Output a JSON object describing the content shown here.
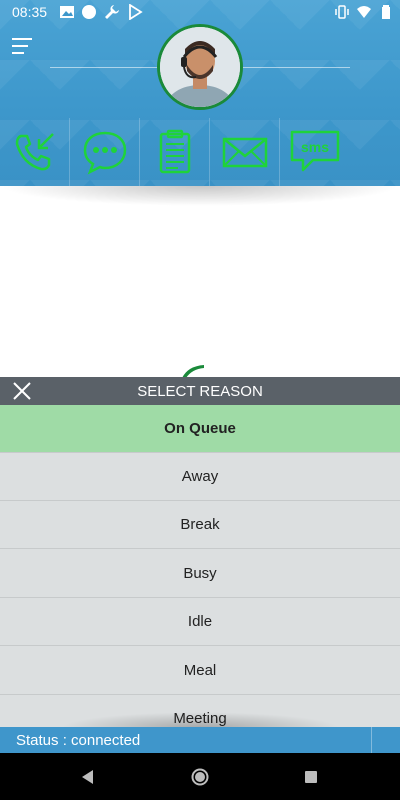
{
  "status_bar": {
    "time": "08:35",
    "left_icons": [
      "image-icon",
      "circle-icon",
      "wrench-icon",
      "play-store-icon"
    ],
    "right_icons": [
      "vibrate-icon",
      "wifi-icon",
      "battery-icon"
    ]
  },
  "header": {
    "menu_icon": "hamburger-menu-icon",
    "avatar": "agent-avatar",
    "actions": [
      {
        "name": "call-log-icon"
      },
      {
        "name": "chat-icon"
      },
      {
        "name": "clipboard-icon"
      },
      {
        "name": "email-icon"
      },
      {
        "name": "sms-icon",
        "text": "sms"
      }
    ]
  },
  "reason_sheet": {
    "title": "SELECT REASON",
    "items": [
      {
        "label": "On Queue",
        "selected": true
      },
      {
        "label": "Away"
      },
      {
        "label": "Break"
      },
      {
        "label": "Busy"
      },
      {
        "label": "Idle"
      },
      {
        "label": "Meal"
      },
      {
        "label": "Meeting"
      }
    ]
  },
  "footer": {
    "status": "Status : connected"
  },
  "colors": {
    "header_blue": "#3d97cb",
    "accent_green": "#1fd33a",
    "selected_green": "#9fdba6",
    "sheet_header": "#5a6168",
    "sheet_bg": "#dcdfe0"
  }
}
